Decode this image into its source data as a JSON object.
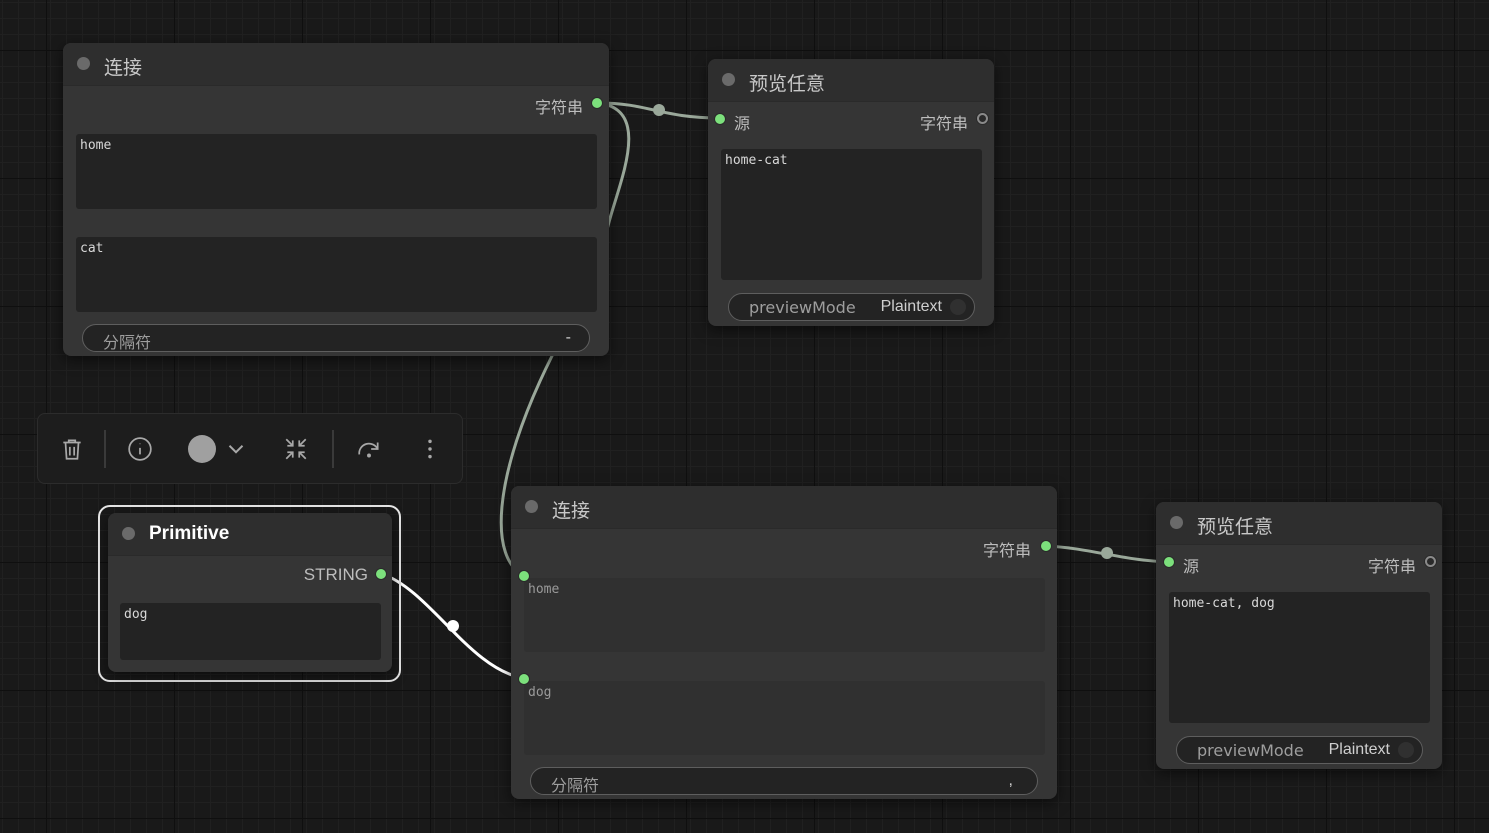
{
  "nodes": {
    "concat1": {
      "title": "连接",
      "output_label": "字符串",
      "text1": "home",
      "text2": "cat",
      "separator": {
        "label": "分隔符",
        "value": "-"
      }
    },
    "preview1": {
      "title": "预览任意",
      "input_label": "源",
      "output_label": "字符串",
      "text": "home-cat",
      "mode": {
        "label": "previewMode",
        "value": "Plaintext"
      }
    },
    "primitive": {
      "title": "Primitive",
      "output_label": "STRING",
      "text": "dog"
    },
    "concat2": {
      "title": "连接",
      "output_label": "字符串",
      "input1_label": "home",
      "input2_label": "dog",
      "separator": {
        "label": "分隔符",
        "value": ","
      }
    },
    "preview2": {
      "title": "预览任意",
      "input_label": "源",
      "output_label": "字符串",
      "text": "home-cat, dog",
      "mode": {
        "label": "previewMode",
        "value": "Plaintext"
      }
    }
  },
  "toolbar": {
    "icons": [
      "trash-icon",
      "info-icon",
      "color-circle-icon",
      "chevron-down-icon",
      "collapse-arrows-icon",
      "redo-arrow-icon",
      "more-vertical-icon"
    ]
  },
  "colors": {
    "canvas": "#191919",
    "node_body": "#353535",
    "node_header": "#2e2e2e",
    "slot_connected": "#7ce07c",
    "link_string": "#9aa89a",
    "link_selected": "#ffffff"
  }
}
